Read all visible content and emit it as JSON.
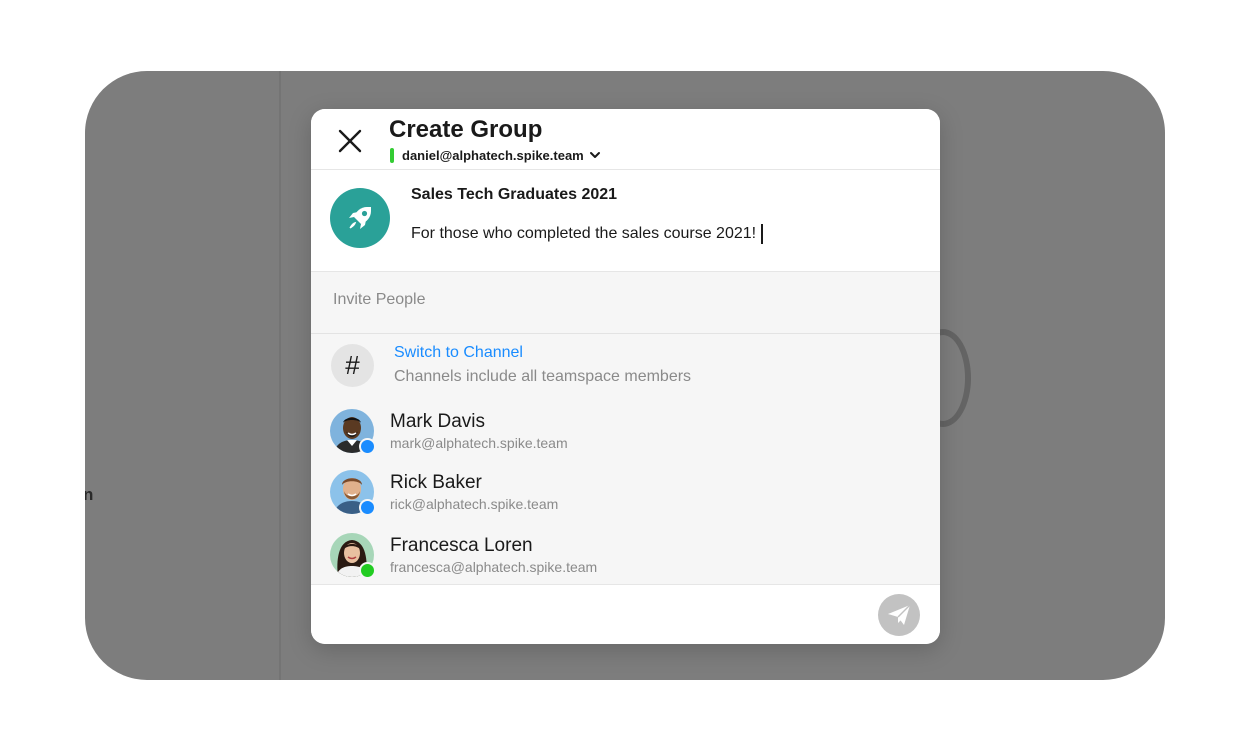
{
  "background": {
    "partial_label": "n"
  },
  "header": {
    "title": "Create Group",
    "account_email": "daniel@alphatech.spike.team",
    "account_status_color": "#33cc33"
  },
  "group": {
    "icon": "rocket-icon",
    "avatar_color": "#2aa198",
    "name": "Sales Tech Graduates 2021",
    "description": "For those who completed the sales course 2021!"
  },
  "invite": {
    "placeholder": "Invite People"
  },
  "channel_option": {
    "title": "Switch to Channel",
    "subtitle": "Channels include all teamspace members"
  },
  "people": [
    {
      "name": "Mark Davis",
      "email": "mark@alphatech.spike.team",
      "status_color": "#1a8cff"
    },
    {
      "name": "Rick Baker",
      "email": "rick@alphatech.spike.team",
      "status_color": "#1a8cff"
    },
    {
      "name": "Francesca Loren",
      "email": "francesca@alphatech.spike.team",
      "status_color": "#22cc22"
    }
  ],
  "colors": {
    "accent": "#1a8cff",
    "send_disabled": "#c2c2c2"
  }
}
